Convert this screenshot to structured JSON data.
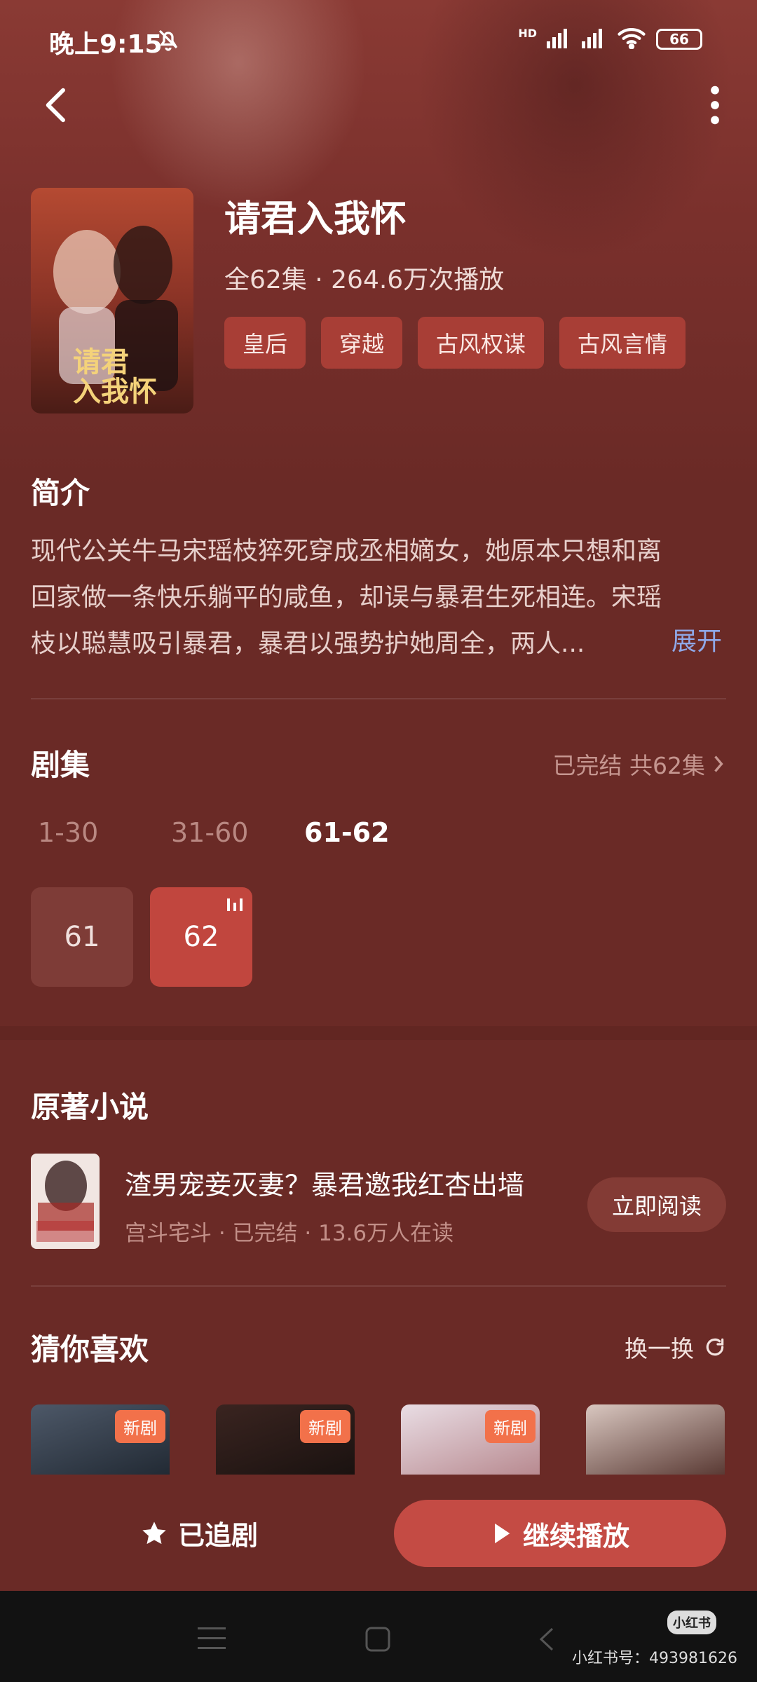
{
  "status_bar": {
    "time": "晚上9:15",
    "battery": "66",
    "network": "HD",
    "icons": [
      "mute-icon",
      "signal-icon",
      "signal-icon",
      "wifi-icon",
      "battery-icon"
    ]
  },
  "header": {
    "back_icon": "back-icon",
    "more_icon": "more-icon"
  },
  "drama": {
    "title": "请君入我怀",
    "meta": "全62集 · 264.6万次播放",
    "tags": [
      "皇后",
      "穿越",
      "古风权谋",
      "古风言情"
    ]
  },
  "intro": {
    "title": "简介",
    "text": "现代公关牛马宋瑶枝猝死穿成丞相嫡女，她原本只想和离回家做一条快乐躺平的咸鱼，却误与暴君生死相连。宋瑶枝以聪慧吸引暴君，暴君以强势护她周全，两人...",
    "expand_label": "展开"
  },
  "episodes": {
    "title": "剧集",
    "status": "已完结 共62集",
    "ranges": [
      "1-30",
      "31-60",
      "61-62"
    ],
    "active_range_index": 2,
    "items": [
      "61",
      "62"
    ],
    "playing_index": 1
  },
  "novel": {
    "section_title": "原著小说",
    "title": "渣男宠妾灭妻？暴君邀我红杏出墙",
    "meta": "宫斗宅斗 · 已完结 · 13.6万人在读",
    "read_label": "立即阅读"
  },
  "recommend": {
    "title": "猜你喜欢",
    "refresh_label": "换一换",
    "cards": [
      {
        "badge": "新剧"
      },
      {
        "badge": "新剧"
      },
      {
        "badge": "新剧"
      },
      {
        "badge": ""
      }
    ]
  },
  "actions": {
    "follow_label": "已追剧",
    "play_label": "继续播放"
  },
  "watermark": {
    "logo": "小红书",
    "id_text": "小红书号：493981626"
  },
  "colors": {
    "background": "#6a2a26",
    "tag_bg": "#a83e36",
    "play_button": "#c44b44",
    "expand_link": "#8fa8e8",
    "new_badge": "#f2714a"
  }
}
